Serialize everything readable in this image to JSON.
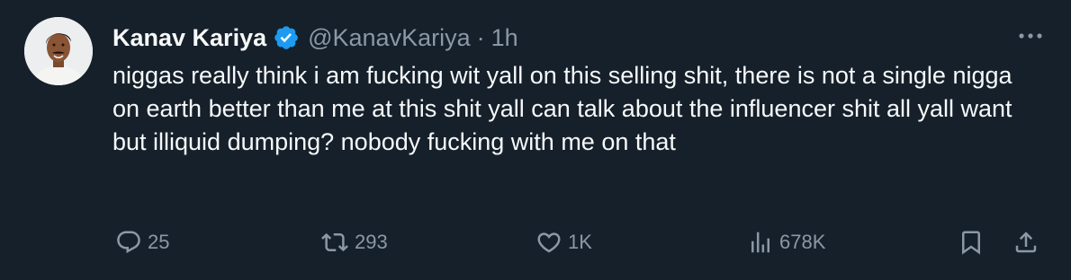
{
  "author": {
    "name": "Kanav Kariya",
    "handle": "@KanavKariya",
    "separator": "·",
    "time": "1h",
    "verified_color": "#1d9bf0"
  },
  "tweet": {
    "text": "niggas really think i am fucking wit yall on this selling shit, there is not a single nigga on earth better than me at this shit yall can talk about the influencer shit all yall want but illiquid dumping? nobody fucking with me on that"
  },
  "actions": {
    "replies": "25",
    "reposts": "293",
    "likes": "1K",
    "views": "678K"
  },
  "icons": [
    "avatar",
    "verified-badge-icon",
    "more-icon",
    "reply-icon",
    "repost-icon",
    "like-icon",
    "views-icon",
    "bookmark-icon",
    "share-icon"
  ],
  "colors": {
    "background": "#15202b",
    "text": "#f7f9f9",
    "muted": "#8b98a5",
    "accent": "#1d9bf0"
  }
}
